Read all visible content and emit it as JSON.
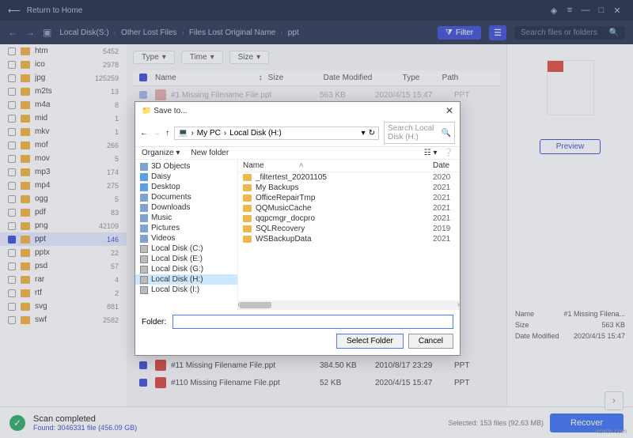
{
  "titlebar": {
    "return_home": "Return to Home"
  },
  "toolbar": {
    "breadcrumb": [
      "Local Disk(S:)",
      "Other Lost Files",
      "Files Lost Original Name",
      "ppt"
    ],
    "filter": "Filter",
    "search_placeholder": "Search files or folders"
  },
  "filters": {
    "type": "Type",
    "time": "Time",
    "size": "Size"
  },
  "columns": {
    "name": "Name",
    "size": "Size",
    "date": "Date Modified",
    "type": "Type",
    "path": "Path"
  },
  "sidebar": {
    "items": [
      {
        "label": "htm",
        "count": "5452"
      },
      {
        "label": "ico",
        "count": "2978"
      },
      {
        "label": "jpg",
        "count": "125259"
      },
      {
        "label": "m2ts",
        "count": "13"
      },
      {
        "label": "m4a",
        "count": "8"
      },
      {
        "label": "mid",
        "count": "1"
      },
      {
        "label": "mkv",
        "count": "1"
      },
      {
        "label": "mof",
        "count": "266"
      },
      {
        "label": "mov",
        "count": "5"
      },
      {
        "label": "mp3",
        "count": "174"
      },
      {
        "label": "mp4",
        "count": "275"
      },
      {
        "label": "ogg",
        "count": "5"
      },
      {
        "label": "pdf",
        "count": "83"
      },
      {
        "label": "png",
        "count": "42109"
      },
      {
        "label": "ppt",
        "count": "146",
        "selected": true,
        "checked": true
      },
      {
        "label": "pptx",
        "count": "22"
      },
      {
        "label": "psd",
        "count": "57"
      },
      {
        "label": "rar",
        "count": "4"
      },
      {
        "label": "rtf",
        "count": "2"
      },
      {
        "label": "svg",
        "count": "881"
      },
      {
        "label": "swf",
        "count": "2582"
      }
    ]
  },
  "files": {
    "row1": {
      "name": "#1 Missing Filename File.ppt",
      "size": "563 KB",
      "date": "2020/4/15 15:47",
      "type": "PPT"
    },
    "row11": {
      "name": "#11 Missing Filename File.ppt",
      "size": "384.50 KB",
      "date": "2010/8/17 23:29",
      "type": "PPT"
    },
    "row110": {
      "name": "#110 Missing Filename File.ppt",
      "size": "52 KB",
      "date": "2020/4/15 15:47",
      "type": "PPT"
    }
  },
  "preview": {
    "button": "Preview",
    "name_label": "Name",
    "name_value": "#1 Missing Filena...",
    "size_label": "Size",
    "size_value": "563 KB",
    "date_label": "Date Modified",
    "date_value": "2020/4/15 15:47"
  },
  "footer": {
    "status_title": "Scan completed",
    "status_sub": "Found: 3046331 file (456.09 GB)",
    "selected": "Selected: 153 files (92.63 MB)",
    "recover": "Recover",
    "watermark": "wsxdn.com"
  },
  "dialog": {
    "title": "Save to...",
    "path": [
      "My PC",
      "Local Disk (H:)"
    ],
    "search_placeholder": "Search Local Disk (H:)",
    "organize": "Organize",
    "new_folder": "New folder",
    "col_name": "Name",
    "col_date": "Date",
    "tree": [
      {
        "label": "3D Objects",
        "icon": "ic-generic"
      },
      {
        "label": "Daisy",
        "icon": "ic-folder-blue"
      },
      {
        "label": "Desktop",
        "icon": "ic-folder-blue"
      },
      {
        "label": "Documents",
        "icon": "ic-generic"
      },
      {
        "label": "Downloads",
        "icon": "ic-generic"
      },
      {
        "label": "Music",
        "icon": "ic-generic"
      },
      {
        "label": "Pictures",
        "icon": "ic-generic"
      },
      {
        "label": "Videos",
        "icon": "ic-generic"
      },
      {
        "label": "Local Disk (C:)",
        "icon": "ic-drive"
      },
      {
        "label": "Local Disk (E:)",
        "icon": "ic-drive"
      },
      {
        "label": "Local Disk (G:)",
        "icon": "ic-drive"
      },
      {
        "label": "Local Disk (H:)",
        "icon": "ic-drive",
        "selected": true
      },
      {
        "label": "Local Disk (I:)",
        "icon": "ic-drive"
      }
    ],
    "listing": [
      {
        "name": "_filtertest_20201105",
        "date": "2020"
      },
      {
        "name": "My Backups",
        "date": "2021"
      },
      {
        "name": "OfficeRepairTmp",
        "date": "2021"
      },
      {
        "name": "QQMusicCache",
        "date": "2021"
      },
      {
        "name": "qqpcmgr_docpro",
        "date": "2021"
      },
      {
        "name": "SQLRecovery",
        "date": "2019"
      },
      {
        "name": "WSBackupData",
        "date": "2021"
      }
    ],
    "folder_label": "Folder:",
    "select_folder": "Select Folder",
    "cancel": "Cancel"
  }
}
